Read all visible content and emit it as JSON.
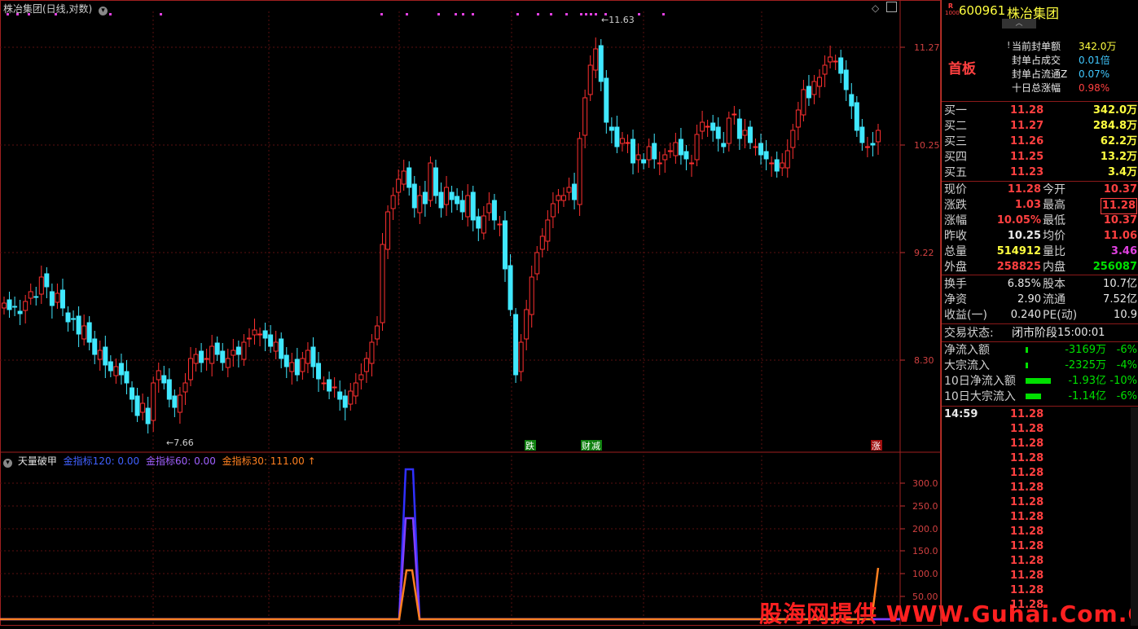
{
  "header": {
    "title": "株冶集团(日线,对数)",
    "top_label": "11.63",
    "low_label": "7.66"
  },
  "price_axis": [
    "11.27",
    "10.25",
    "9.22",
    "8.30"
  ],
  "indicator": {
    "name": "天量破甲",
    "line1": "金指标120: 0.00",
    "line2": "金指标60: 0.00",
    "line3": "金指标30: 111.00",
    "axis": [
      "300.0",
      "250.0",
      "200.0",
      "150.0",
      "100.0",
      "50.00"
    ]
  },
  "markers": {
    "m1": "跌",
    "m2": "财",
    "m3": "减",
    "m4": "涨"
  },
  "colors": {
    "up": "#ff3030",
    "down": "#40e8ff",
    "line120": "#3030ff",
    "line60": "#8040ff",
    "line30": "#ff8020"
  },
  "stock": {
    "code": "600961",
    "name": "株冶集团",
    "badge_top": "R",
    "badge_bottom": "1000"
  },
  "board": {
    "label": "首板",
    "items": [
      {
        "k": "当前封单额",
        "v": "342.0万"
      },
      {
        "k": "封单占成交",
        "v": "0.01倍"
      },
      {
        "k": "封单占流通Z",
        "v": "0.07%"
      },
      {
        "k": "十日总涨幅",
        "v": "0.98%"
      }
    ]
  },
  "bids": [
    {
      "k": "买一",
      "p": "11.28",
      "v": "342.0万"
    },
    {
      "k": "买二",
      "p": "11.27",
      "v": "284.8万"
    },
    {
      "k": "买三",
      "p": "11.26",
      "v": "62.2万"
    },
    {
      "k": "买四",
      "p": "11.25",
      "v": "13.2万"
    },
    {
      "k": "买五",
      "p": "11.23",
      "v": "3.4万"
    }
  ],
  "quote": [
    {
      "k1": "现价",
      "v1": "11.28",
      "k2": "今开",
      "v2": "10.37"
    },
    {
      "k1": "涨跌",
      "v1": "1.03",
      "k2": "最高",
      "v2": "11.28"
    },
    {
      "k1": "涨幅",
      "v1": "10.05%",
      "k2": "最低",
      "v2": "10.37"
    },
    {
      "k1": "昨收",
      "v1": "10.25",
      "k2": "均价",
      "v2": "11.06"
    },
    {
      "k1": "总量",
      "v1": "514912",
      "k2": "量比",
      "v2": "3.46"
    },
    {
      "k1": "外盘",
      "v1": "258825",
      "k2": "内盘",
      "v2": "256087"
    }
  ],
  "fundamentals": [
    {
      "k1": "换手",
      "v1": "6.85%",
      "k2": "股本",
      "v2": "10.7亿"
    },
    {
      "k1": "净资",
      "v1": "2.90",
      "k2": "流通",
      "v2": "7.52亿"
    },
    {
      "k1": "收益(一)",
      "v1": "0.240",
      "k2": "PE(动)",
      "v2": "10.9"
    }
  ],
  "status": {
    "k": "交易状态:",
    "v": "闭市阶段",
    "time": "15:00:01"
  },
  "flows": [
    {
      "k": "净流入额",
      "v": "-3169万",
      "p": "-6%",
      "bar": 0.08
    },
    {
      "k": "大宗流入",
      "v": "-2325万",
      "p": "-4%",
      "bar": 0.04
    },
    {
      "k": "10日净流入额",
      "v": "-1.93亿",
      "p": "-10%",
      "bar": 0.9
    },
    {
      "k": "10日大宗流入",
      "v": "-1.14亿",
      "p": "-6%",
      "bar": 0.55
    }
  ],
  "ticks": {
    "time": "14:59",
    "prices": [
      "11.28",
      "11.28",
      "11.28",
      "11.28",
      "11.28",
      "11.28",
      "11.28",
      "11.28",
      "11.28",
      "11.28",
      "11.28",
      "11.28",
      "11.28",
      "11.28"
    ]
  },
  "watermark": "股海网提供 WWW.Guhai.Com.CN"
}
